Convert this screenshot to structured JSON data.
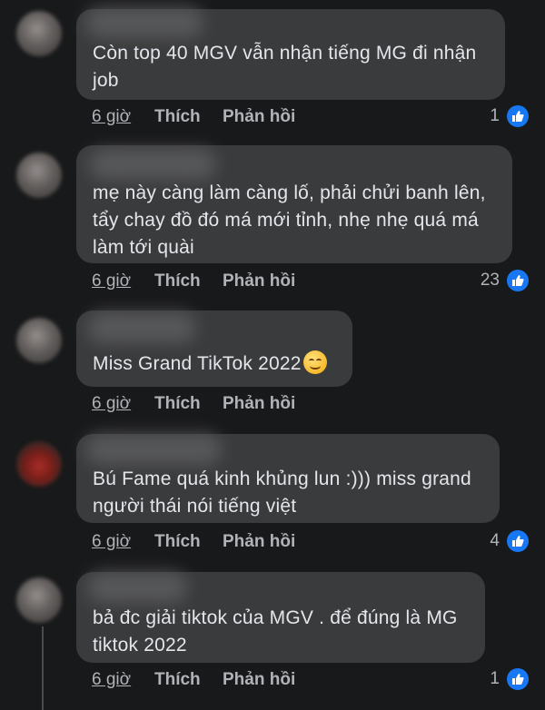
{
  "comments": [
    {
      "text": "Còn top 40 MGV vẫn nhận tiếng MG đi nhận job",
      "time": "6 giờ",
      "like": "Thích",
      "reply": "Phản hồi",
      "reactions": "1"
    },
    {
      "text": "mẹ này càng làm càng lố, phải chửi banh lên, tẩy chay đồ đó má mới tỉnh, nhẹ nhẹ quá má làm tới quài",
      "time": "6 giờ",
      "like": "Thích",
      "reply": "Phản hồi",
      "reactions": "23"
    },
    {
      "text": "Miss Grand TikTok 2022",
      "time": "6 giờ",
      "like": "Thích",
      "reply": "Phản hồi",
      "reactions": ""
    },
    {
      "text": "Bú Fame quá kinh khủng lun :))) miss grand người thái nói tiếng việt",
      "time": "6 giờ",
      "like": "Thích",
      "reply": "Phản hồi",
      "reactions": "4"
    },
    {
      "text": "bả đc giải tiktok của MGV . để đúng là MG tiktok 2022",
      "time": "6 giờ",
      "like": "Thích",
      "reply": "Phản hồi",
      "reactions": "1"
    }
  ],
  "colors": {
    "background": "#18191a",
    "bubble": "#3a3b3c",
    "text": "#e4e6eb",
    "secondary": "#b0b3b8",
    "like_blue": "#1877f2"
  },
  "icons": {
    "reaction": "like-icon",
    "emoji": "smiling-face-emoji"
  }
}
